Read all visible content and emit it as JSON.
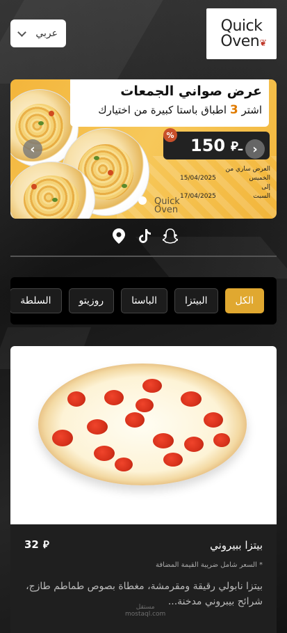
{
  "header": {
    "language_selected": "عربي",
    "logo_line1": "Quick",
    "logo_line2": "Oven"
  },
  "banner": {
    "offer_title": "عرض صواني الجمعات",
    "offer_sub_before": "اشتر",
    "offer_sub_number": "3",
    "offer_sub_after": "اطباق باستا كبيرة من اختيارك",
    "price": "150",
    "currency": "⃁ـ",
    "percent_badge": "%",
    "dates": {
      "label": "العرض ساري من",
      "from_day": "الخميس",
      "from_date": "15/04/2025",
      "to": "إلى",
      "to_day": "السبت",
      "to_date": "17/04/2025"
    },
    "watermark_logo_1": "Quick",
    "watermark_logo_2": "Oven",
    "prev_icon": "chevron-left-icon",
    "next_icon": "chevron-right-icon"
  },
  "social": {
    "icons": [
      "snapchat-icon",
      "tiktok-icon",
      "location-pin-icon"
    ]
  },
  "categories": [
    {
      "label": "الكل",
      "active": true
    },
    {
      "label": "البيتزا",
      "active": false
    },
    {
      "label": "الباستا",
      "active": false
    },
    {
      "label": "روزيتو",
      "active": false
    },
    {
      "label": "السلطة",
      "active": false
    }
  ],
  "product": {
    "name": "بيتزا ببيروني",
    "price": "32",
    "currency": "⃁",
    "vat_note": "* السعر شامل ضريبة القيمة المضافة",
    "description": "بيتزا نابولي رقيقة ومقرمشة، مغطاة بصوص طماطم طازج، شرائح بيبروني مدخنة..."
  },
  "watermark": {
    "line1": "مستقل",
    "line2": "mostaql.com"
  },
  "colors": {
    "accent": "#e0a830",
    "background": "#1b1b1b",
    "card": "#1f1f1f",
    "banner": "#f3b53b"
  }
}
